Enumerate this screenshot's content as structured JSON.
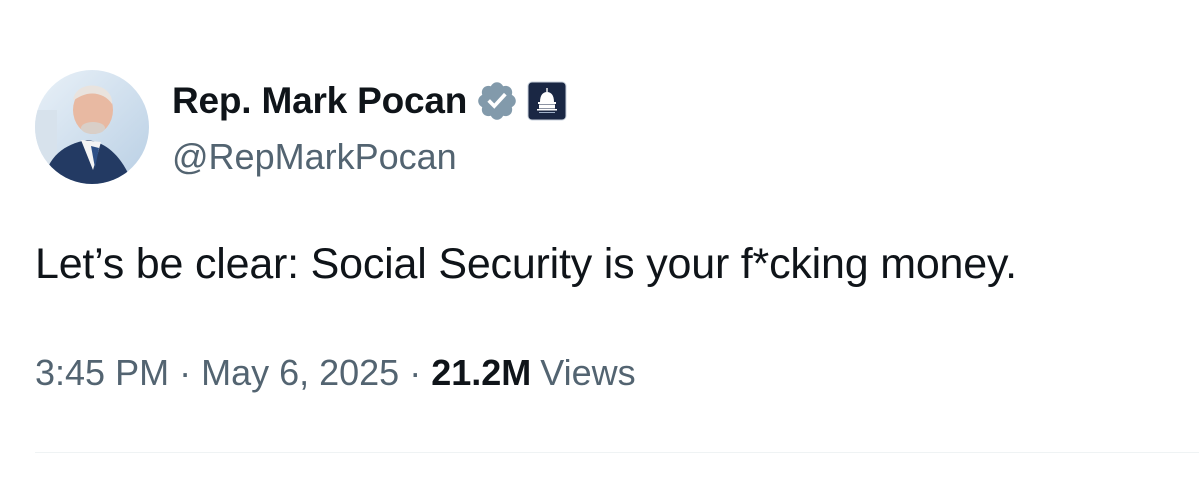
{
  "tweet": {
    "author": {
      "display_name": "Rep. Mark Pocan",
      "handle": "@RepMarkPocan",
      "verified_icon": "verified-badge-icon",
      "affiliation_icon": "capitol-dome-icon"
    },
    "text": "Let’s be clear: Social Security is your f*cking money.",
    "meta": {
      "time": "3:45 PM",
      "separator": "·",
      "date": "May 6, 2025",
      "views_count": "21.2M",
      "views_label": "Views"
    }
  },
  "colors": {
    "text_primary": "#0f1419",
    "text_secondary": "#536471",
    "verified_badge": "#829aab",
    "divider": "#eff3f4"
  }
}
